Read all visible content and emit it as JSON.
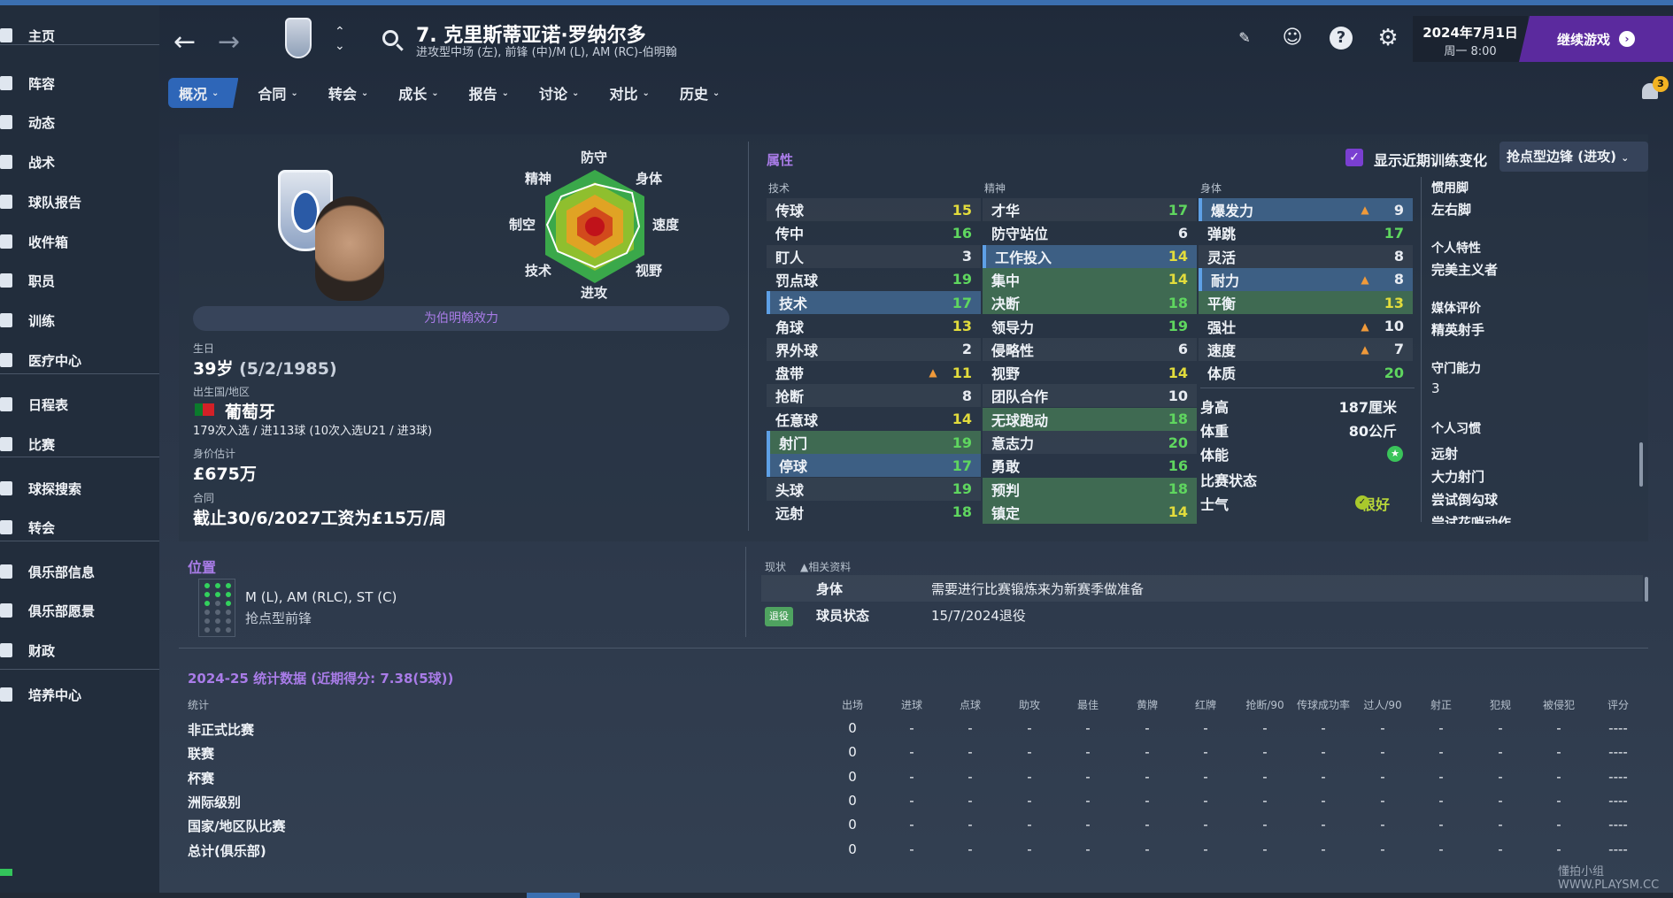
{
  "sidebar": {
    "items": [
      {
        "label": "主页",
        "icon": "home-icon"
      },
      {
        "label": "阵容",
        "icon": "squad-icon"
      },
      {
        "label": "动态",
        "icon": "dynamics-icon"
      },
      {
        "label": "战术",
        "icon": "tactics-icon"
      },
      {
        "label": "球队报告",
        "icon": "report-icon"
      },
      {
        "label": "收件箱",
        "icon": "inbox-icon"
      },
      {
        "label": "职员",
        "icon": "staff-icon"
      },
      {
        "label": "训练",
        "icon": "training-icon"
      },
      {
        "label": "医疗中心",
        "icon": "medical-icon"
      },
      {
        "label": "日程表",
        "icon": "calendar-icon"
      },
      {
        "label": "比赛",
        "icon": "trophy-icon"
      },
      {
        "label": "球探搜索",
        "icon": "scouting-icon"
      },
      {
        "label": "转会",
        "icon": "transfer-icon"
      },
      {
        "label": "俱乐部信息",
        "icon": "club-info-icon"
      },
      {
        "label": "俱乐部愿景",
        "icon": "club-vision-icon"
      },
      {
        "label": "财政",
        "icon": "finance-icon"
      },
      {
        "label": "培养中心",
        "icon": "development-icon"
      }
    ]
  },
  "header": {
    "player_name": "7. 克里斯蒂亚诺·罗纳尔多",
    "player_sub": "进攻型中场 (左), 前锋 (中)/M (L), AM (RC)-伯明翰",
    "date": "2024年7月1日",
    "time": "周一 8:00",
    "continue_label": "继续游戏",
    "notification_count": "3"
  },
  "tabs": [
    {
      "label": "概况",
      "active": true
    },
    {
      "label": "合同"
    },
    {
      "label": "转会"
    },
    {
      "label": "成长"
    },
    {
      "label": "报告"
    },
    {
      "label": "讨论"
    },
    {
      "label": "对比"
    },
    {
      "label": "历史"
    }
  ],
  "profile": {
    "plays_for": "为伯明翰效力",
    "radar_labels": {
      "top": "防守",
      "top_right": "身体",
      "right": "速度",
      "bottom_right": "视野",
      "bottom": "进攻",
      "bottom_left": "技术",
      "left": "制空",
      "top_left": "精神"
    },
    "birth_label": "生日",
    "birth_value": "39岁",
    "birth_date": "(5/2/1985)",
    "nation_label": "出生国/地区",
    "nation_value": "葡萄牙",
    "caps": "179次入选 / 进113球 (10次入选U21 / 进3球)",
    "value_label": "身价估计",
    "value": "£675万",
    "contract_label": "合同",
    "contract": "截止30/6/2027工资为£15万/周"
  },
  "attributes": {
    "title": "属性",
    "show_changes_label": "显示近期训练变化",
    "role_dropdown": "抢点型边锋 (进攻)",
    "technical_header": "技术",
    "mental_header": "精神",
    "physical_header": "身体",
    "technical": [
      {
        "name": "传球",
        "value": "15"
      },
      {
        "name": "传中",
        "value": "16"
      },
      {
        "name": "盯人",
        "value": "3"
      },
      {
        "name": "罚点球",
        "value": "19"
      },
      {
        "name": "技术",
        "value": "17"
      },
      {
        "name": "角球",
        "value": "13"
      },
      {
        "name": "界外球",
        "value": "2"
      },
      {
        "name": "盘带",
        "value": "11"
      },
      {
        "name": "抢断",
        "value": "8"
      },
      {
        "name": "任意球",
        "value": "14"
      },
      {
        "name": "射门",
        "value": "19"
      },
      {
        "name": "停球",
        "value": "17"
      },
      {
        "name": "头球",
        "value": "19"
      },
      {
        "name": "远射",
        "value": "18"
      }
    ],
    "mental": [
      {
        "name": "才华",
        "value": "17"
      },
      {
        "name": "防守站位",
        "value": "6"
      },
      {
        "name": "工作投入",
        "value": "14"
      },
      {
        "name": "集中",
        "value": "14"
      },
      {
        "name": "决断",
        "value": "18"
      },
      {
        "name": "领导力",
        "value": "19"
      },
      {
        "name": "侵略性",
        "value": "6"
      },
      {
        "name": "视野",
        "value": "14"
      },
      {
        "name": "团队合作",
        "value": "10"
      },
      {
        "name": "无球跑动",
        "value": "18"
      },
      {
        "name": "意志力",
        "value": "20"
      },
      {
        "name": "勇敢",
        "value": "16"
      },
      {
        "name": "预判",
        "value": "18"
      },
      {
        "name": "镇定",
        "value": "14"
      }
    ],
    "physical": [
      {
        "name": "爆发力",
        "value": "9"
      },
      {
        "name": "弹跳",
        "value": "17"
      },
      {
        "name": "灵活",
        "value": "8"
      },
      {
        "name": "耐力",
        "value": "8"
      },
      {
        "name": "平衡",
        "value": "13"
      },
      {
        "name": "强壮",
        "value": "10"
      },
      {
        "name": "速度",
        "value": "7"
      },
      {
        "name": "体质",
        "value": "20"
      }
    ],
    "body": [
      {
        "name": "身高",
        "value": "187厘米"
      },
      {
        "name": "体重",
        "value": "80公斤"
      },
      {
        "name": "体能",
        "value": ""
      },
      {
        "name": "比赛状态",
        "value": ""
      },
      {
        "name": "士气",
        "value": "很好"
      }
    ]
  },
  "right_info": {
    "foot_label": "惯用脚",
    "foot_value": "左右脚",
    "traits_label": "个人特性",
    "traits_value": "完美主义者",
    "media_label": "媒体评价",
    "media_value": "精英射手",
    "gk_label": "守门能力",
    "gk_value": "3",
    "habits_label": "个人习惯",
    "habits": [
      "远射",
      "大力射门",
      "尝试倒勾球",
      "尝试花哨动作"
    ]
  },
  "position": {
    "title": "位置",
    "positions": "M (L), AM (RLC), ST (C)",
    "role": "抢点型前锋"
  },
  "current": {
    "head_status": "现状",
    "head_related": "▲相关资料",
    "rows": [
      {
        "key": "身体",
        "value": "需要进行比赛锻炼来为新赛季做准备"
      },
      {
        "key": "球员状态",
        "value": "15/7/2024退役"
      }
    ],
    "retired_badge": "退役"
  },
  "stats": {
    "title": "2024-25 统计数据 (近期得分: 7.38(5球))",
    "first_col": "统计",
    "columns": [
      "出场",
      "进球",
      "点球",
      "助攻",
      "最佳",
      "黄牌",
      "红牌",
      "抢断/90",
      "传球成功率",
      "过人/90",
      "射正",
      "犯规",
      "被侵犯",
      "评分"
    ],
    "rows": [
      {
        "label": "非正式比赛",
        "cells": [
          "0",
          "-",
          "-",
          "-",
          "-",
          "-",
          "-",
          "-",
          "-",
          "-",
          "-",
          "-",
          "-",
          "----"
        ]
      },
      {
        "label": "联赛",
        "cells": [
          "0",
          "-",
          "-",
          "-",
          "-",
          "-",
          "-",
          "-",
          "-",
          "-",
          "-",
          "-",
          "-",
          "----"
        ]
      },
      {
        "label": "杯赛",
        "cells": [
          "0",
          "-",
          "-",
          "-",
          "-",
          "-",
          "-",
          "-",
          "-",
          "-",
          "-",
          "-",
          "-",
          "----"
        ]
      },
      {
        "label": "洲际级别",
        "cells": [
          "0",
          "-",
          "-",
          "-",
          "-",
          "-",
          "-",
          "-",
          "-",
          "-",
          "-",
          "-",
          "-",
          "----"
        ]
      },
      {
        "label": "国家/地区队比赛",
        "cells": [
          "0",
          "-",
          "-",
          "-",
          "-",
          "-",
          "-",
          "-",
          "-",
          "-",
          "-",
          "-",
          "-",
          "----"
        ]
      },
      {
        "label": "总计(俱乐部)",
        "cells": [
          "0",
          "-",
          "-",
          "-",
          "-",
          "-",
          "-",
          "-",
          "-",
          "-",
          "-",
          "-",
          "-",
          "----"
        ]
      }
    ]
  },
  "watermark": "懂拍小组 WWW.PLAYSM.CC"
}
